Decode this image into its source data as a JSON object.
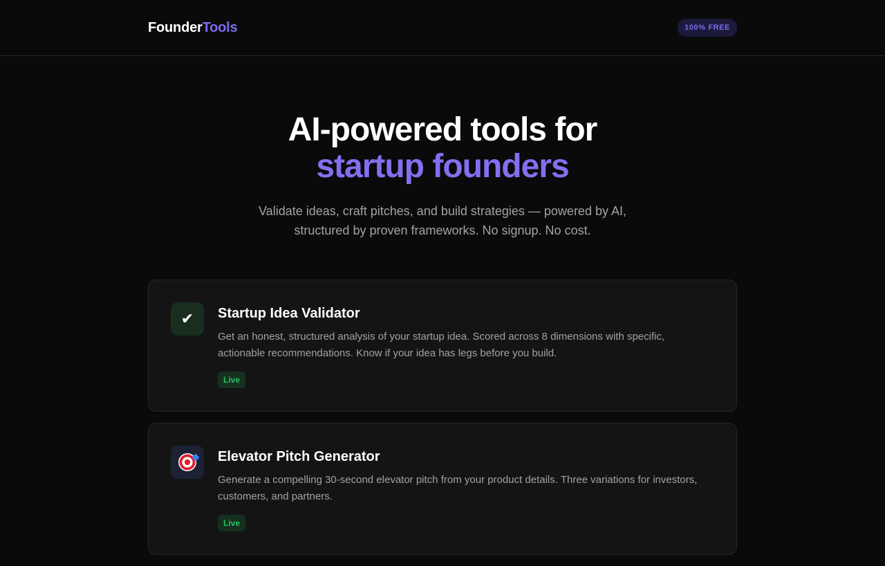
{
  "header": {
    "logo_part1": "Founder",
    "logo_part2": "Tools",
    "badge": "100% FREE"
  },
  "hero": {
    "title_line1": "AI-powered tools for",
    "title_line2": "startup founders",
    "subtitle_line1": "Validate ideas, craft pitches, and build strategies — powered by AI,",
    "subtitle_line2": "structured by proven frameworks. No signup. No cost."
  },
  "tools": [
    {
      "icon": "checkmark-icon",
      "icon_glyph": "✔",
      "title": "Startup Idea Validator",
      "description_line1": "Get an honest, structured analysis of your startup idea. Scored across 8 dimensions with specific,",
      "description_line2": "actionable recommendations. Know if your idea has legs before you build.",
      "status": "Live"
    },
    {
      "icon": "target-icon",
      "title": "Elevator Pitch Generator",
      "description_line1": "Generate a compelling 30-second elevator pitch from your product details. Three variations for investors,",
      "description_line2": "customers, and partners.",
      "status": "Live"
    }
  ],
  "colors": {
    "background": "#0a0a0a",
    "accent": "#7c6cf0",
    "live_green": "#22c55e"
  }
}
